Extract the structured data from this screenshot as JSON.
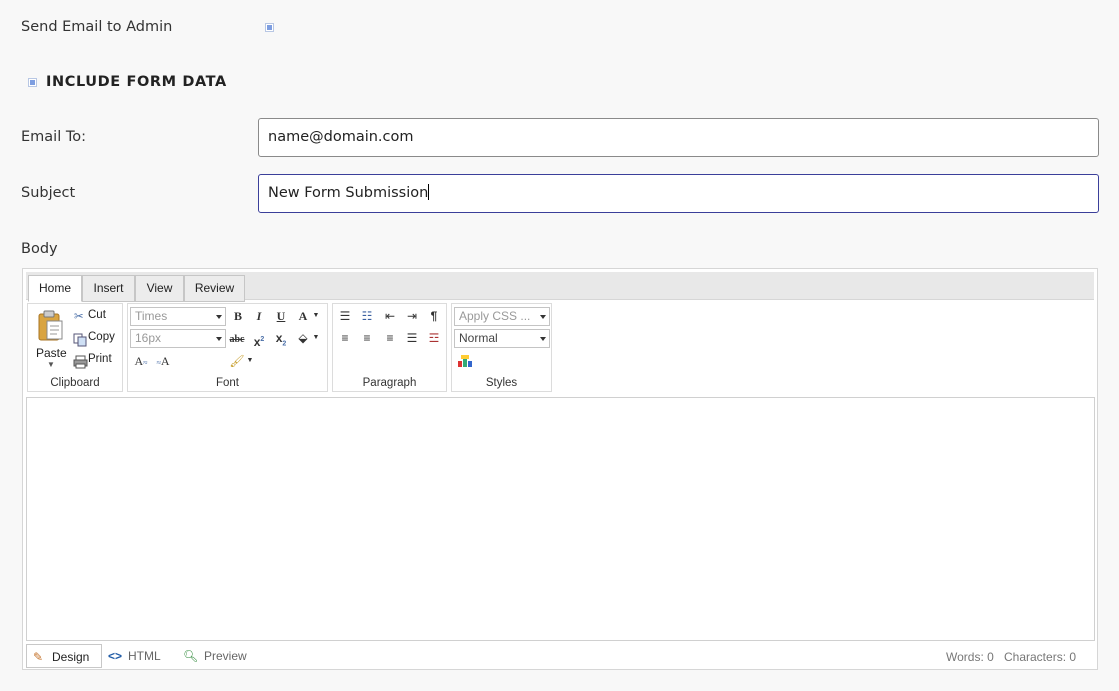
{
  "form": {
    "send_email_label": "Send Email to Admin",
    "send_email_checked": true,
    "include_form_data_label": "INCLUDE FORM DATA",
    "include_form_data_checked": true,
    "email_to_label": "Email To:",
    "email_to_value": "name@domain.com",
    "subject_label": "Subject",
    "subject_value": "New Form Submission",
    "body_label": "Body"
  },
  "editor": {
    "tabs": [
      "Home",
      "Insert",
      "View",
      "Review"
    ],
    "active_tab": "Home",
    "clipboard": {
      "paste_label": "Paste",
      "cut_label": "Cut",
      "copy_label": "Copy",
      "print_label": "Print",
      "group_label": "Clipboard"
    },
    "font": {
      "family_value": "Times",
      "size_value": "16px",
      "group_label": "Font"
    },
    "paragraph": {
      "group_label": "Paragraph"
    },
    "styles": {
      "css_class_value": "Apply CSS ...",
      "format_value": "Normal",
      "group_label": "Styles"
    },
    "modes": {
      "design_label": "Design",
      "html_label": "HTML",
      "preview_label": "Preview"
    },
    "words_text": "Words: 0",
    "characters_text": "Characters: 0"
  },
  "icons": [
    "paste-icon",
    "cut-icon",
    "copy-icon",
    "print-icon",
    "bold-icon",
    "italic-icon",
    "underline-icon",
    "font-color-icon",
    "strikethrough-icon",
    "superscript-icon",
    "subscript-icon",
    "highlight-icon",
    "clear-format-icon",
    "spell-icon",
    "format-painter-icon",
    "bullet-list-icon",
    "numbered-list-icon",
    "outdent-icon",
    "indent-icon",
    "paragraph-mark-icon",
    "align-left-icon",
    "align-center-icon",
    "align-right-icon",
    "justify-icon",
    "horizontal-rule-icon",
    "css-style-icon",
    "pencil-icon",
    "code-icon",
    "magnifier-icon"
  ]
}
